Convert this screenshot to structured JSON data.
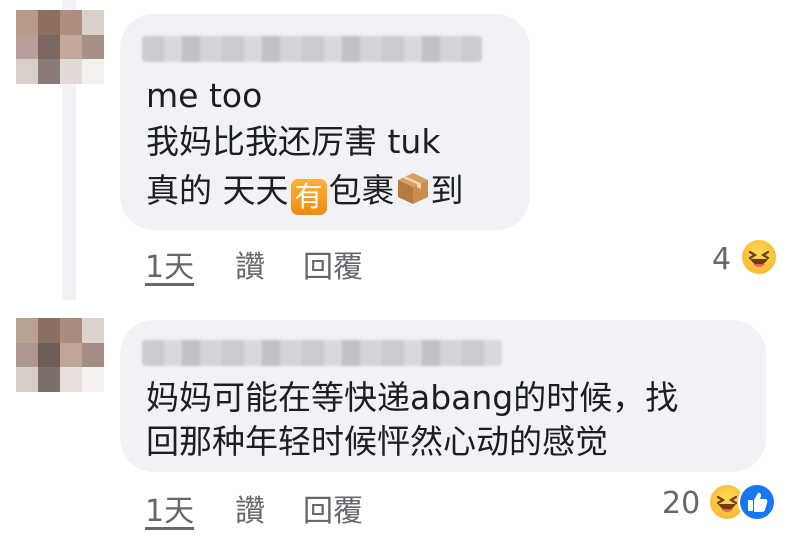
{
  "comments": [
    {
      "lines": [
        "me too",
        "我妈比我还厉害 tuk"
      ],
      "line3": {
        "before": "真的 天天",
        "badge": "有",
        "middle": "包裹",
        "after": "到"
      },
      "time": "1天",
      "like": "讚",
      "reply": "回覆",
      "reaction_count": "4",
      "reactions": [
        "laughing-emoji"
      ]
    },
    {
      "lines": [
        "妈妈可能在等快递abang的时候，找",
        "回那种年轻时候怦然心动的感觉"
      ],
      "time": "1天",
      "like": "讚",
      "reply": "回覆",
      "reaction_count": "20",
      "reactions": [
        "laughing-emoji",
        "like-emoji"
      ]
    }
  ],
  "colors": {
    "bubble": "#f0f2f5",
    "text": "#1c1e21",
    "muted": "#65676b",
    "like_blue": "#1877f2"
  }
}
